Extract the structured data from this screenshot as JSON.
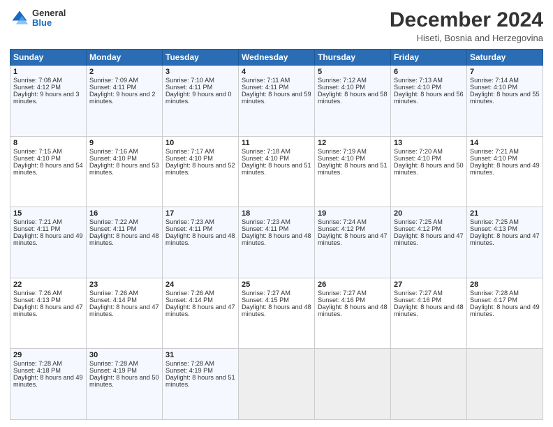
{
  "logo": {
    "general": "General",
    "blue": "Blue"
  },
  "title": "December 2024",
  "subtitle": "Hiseti, Bosnia and Herzegovina",
  "days_header": [
    "Sunday",
    "Monday",
    "Tuesday",
    "Wednesday",
    "Thursday",
    "Friday",
    "Saturday"
  ],
  "weeks": [
    [
      {
        "day": "1",
        "sunrise": "Sunrise: 7:08 AM",
        "sunset": "Sunset: 4:12 PM",
        "daylight": "Daylight: 9 hours and 3 minutes."
      },
      {
        "day": "2",
        "sunrise": "Sunrise: 7:09 AM",
        "sunset": "Sunset: 4:11 PM",
        "daylight": "Daylight: 9 hours and 2 minutes."
      },
      {
        "day": "3",
        "sunrise": "Sunrise: 7:10 AM",
        "sunset": "Sunset: 4:11 PM",
        "daylight": "Daylight: 9 hours and 0 minutes."
      },
      {
        "day": "4",
        "sunrise": "Sunrise: 7:11 AM",
        "sunset": "Sunset: 4:11 PM",
        "daylight": "Daylight: 8 hours and 59 minutes."
      },
      {
        "day": "5",
        "sunrise": "Sunrise: 7:12 AM",
        "sunset": "Sunset: 4:10 PM",
        "daylight": "Daylight: 8 hours and 58 minutes."
      },
      {
        "day": "6",
        "sunrise": "Sunrise: 7:13 AM",
        "sunset": "Sunset: 4:10 PM",
        "daylight": "Daylight: 8 hours and 56 minutes."
      },
      {
        "day": "7",
        "sunrise": "Sunrise: 7:14 AM",
        "sunset": "Sunset: 4:10 PM",
        "daylight": "Daylight: 8 hours and 55 minutes."
      }
    ],
    [
      {
        "day": "8",
        "sunrise": "Sunrise: 7:15 AM",
        "sunset": "Sunset: 4:10 PM",
        "daylight": "Daylight: 8 hours and 54 minutes."
      },
      {
        "day": "9",
        "sunrise": "Sunrise: 7:16 AM",
        "sunset": "Sunset: 4:10 PM",
        "daylight": "Daylight: 8 hours and 53 minutes."
      },
      {
        "day": "10",
        "sunrise": "Sunrise: 7:17 AM",
        "sunset": "Sunset: 4:10 PM",
        "daylight": "Daylight: 8 hours and 52 minutes."
      },
      {
        "day": "11",
        "sunrise": "Sunrise: 7:18 AM",
        "sunset": "Sunset: 4:10 PM",
        "daylight": "Daylight: 8 hours and 51 minutes."
      },
      {
        "day": "12",
        "sunrise": "Sunrise: 7:19 AM",
        "sunset": "Sunset: 4:10 PM",
        "daylight": "Daylight: 8 hours and 51 minutes."
      },
      {
        "day": "13",
        "sunrise": "Sunrise: 7:20 AM",
        "sunset": "Sunset: 4:10 PM",
        "daylight": "Daylight: 8 hours and 50 minutes."
      },
      {
        "day": "14",
        "sunrise": "Sunrise: 7:21 AM",
        "sunset": "Sunset: 4:10 PM",
        "daylight": "Daylight: 8 hours and 49 minutes."
      }
    ],
    [
      {
        "day": "15",
        "sunrise": "Sunrise: 7:21 AM",
        "sunset": "Sunset: 4:11 PM",
        "daylight": "Daylight: 8 hours and 49 minutes."
      },
      {
        "day": "16",
        "sunrise": "Sunrise: 7:22 AM",
        "sunset": "Sunset: 4:11 PM",
        "daylight": "Daylight: 8 hours and 48 minutes."
      },
      {
        "day": "17",
        "sunrise": "Sunrise: 7:23 AM",
        "sunset": "Sunset: 4:11 PM",
        "daylight": "Daylight: 8 hours and 48 minutes."
      },
      {
        "day": "18",
        "sunrise": "Sunrise: 7:23 AM",
        "sunset": "Sunset: 4:11 PM",
        "daylight": "Daylight: 8 hours and 48 minutes."
      },
      {
        "day": "19",
        "sunrise": "Sunrise: 7:24 AM",
        "sunset": "Sunset: 4:12 PM",
        "daylight": "Daylight: 8 hours and 47 minutes."
      },
      {
        "day": "20",
        "sunrise": "Sunrise: 7:25 AM",
        "sunset": "Sunset: 4:12 PM",
        "daylight": "Daylight: 8 hours and 47 minutes."
      },
      {
        "day": "21",
        "sunrise": "Sunrise: 7:25 AM",
        "sunset": "Sunset: 4:13 PM",
        "daylight": "Daylight: 8 hours and 47 minutes."
      }
    ],
    [
      {
        "day": "22",
        "sunrise": "Sunrise: 7:26 AM",
        "sunset": "Sunset: 4:13 PM",
        "daylight": "Daylight: 8 hours and 47 minutes."
      },
      {
        "day": "23",
        "sunrise": "Sunrise: 7:26 AM",
        "sunset": "Sunset: 4:14 PM",
        "daylight": "Daylight: 8 hours and 47 minutes."
      },
      {
        "day": "24",
        "sunrise": "Sunrise: 7:26 AM",
        "sunset": "Sunset: 4:14 PM",
        "daylight": "Daylight: 8 hours and 47 minutes."
      },
      {
        "day": "25",
        "sunrise": "Sunrise: 7:27 AM",
        "sunset": "Sunset: 4:15 PM",
        "daylight": "Daylight: 8 hours and 48 minutes."
      },
      {
        "day": "26",
        "sunrise": "Sunrise: 7:27 AM",
        "sunset": "Sunset: 4:16 PM",
        "daylight": "Daylight: 8 hours and 48 minutes."
      },
      {
        "day": "27",
        "sunrise": "Sunrise: 7:27 AM",
        "sunset": "Sunset: 4:16 PM",
        "daylight": "Daylight: 8 hours and 48 minutes."
      },
      {
        "day": "28",
        "sunrise": "Sunrise: 7:28 AM",
        "sunset": "Sunset: 4:17 PM",
        "daylight": "Daylight: 8 hours and 49 minutes."
      }
    ],
    [
      {
        "day": "29",
        "sunrise": "Sunrise: 7:28 AM",
        "sunset": "Sunset: 4:18 PM",
        "daylight": "Daylight: 8 hours and 49 minutes."
      },
      {
        "day": "30",
        "sunrise": "Sunrise: 7:28 AM",
        "sunset": "Sunset: 4:19 PM",
        "daylight": "Daylight: 8 hours and 50 minutes."
      },
      {
        "day": "31",
        "sunrise": "Sunrise: 7:28 AM",
        "sunset": "Sunset: 4:19 PM",
        "daylight": "Daylight: 8 hours and 51 minutes."
      },
      null,
      null,
      null,
      null
    ]
  ]
}
